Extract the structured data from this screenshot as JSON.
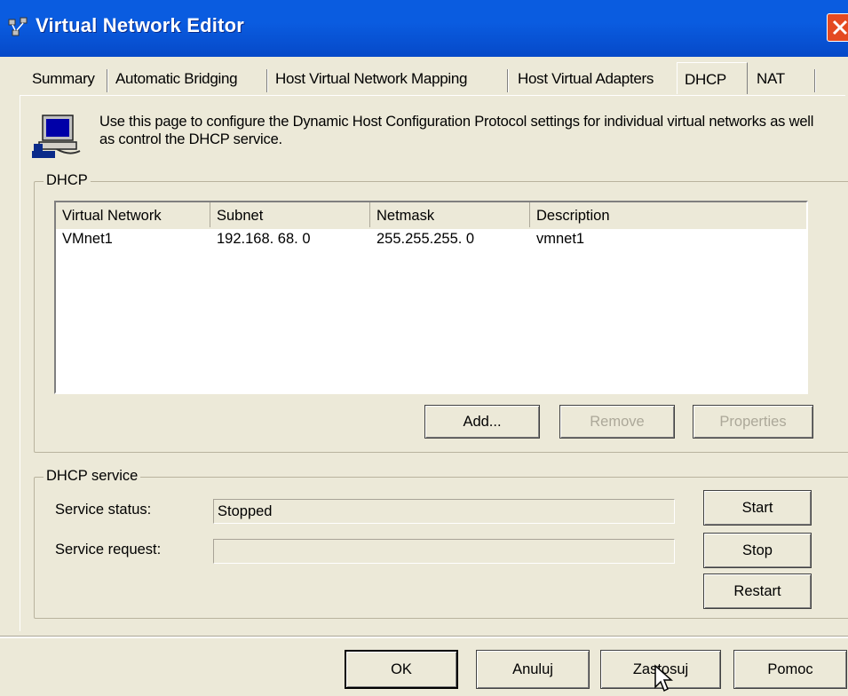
{
  "window": {
    "title": "Virtual Network Editor"
  },
  "tabs": [
    {
      "label": "Summary"
    },
    {
      "label": "Automatic Bridging"
    },
    {
      "label": "Host Virtual Network Mapping"
    },
    {
      "label": "Host Virtual Adapters"
    },
    {
      "label": "DHCP",
      "selected": true
    },
    {
      "label": "NAT"
    }
  ],
  "intro": {
    "text": "Use this page to configure the Dynamic Host Configuration Protocol settings for individual virtual networks as well as control the DHCP service."
  },
  "dhcp": {
    "group_label": "DHCP",
    "columns": [
      "Virtual Network",
      "Subnet",
      "Netmask",
      "Description"
    ],
    "rows": [
      {
        "network": "VMnet1",
        "subnet": "192.168. 68.  0",
        "netmask": "255.255.255.  0",
        "description": "vmnet1"
      }
    ],
    "buttons": {
      "add": "Add...",
      "remove": "Remove",
      "properties": "Properties"
    }
  },
  "service": {
    "group_label": "DHCP service",
    "status_label": "Service status:",
    "status_value": "Stopped",
    "request_label": "Service request:",
    "request_value": "",
    "buttons": {
      "start": "Start",
      "stop": "Stop",
      "restart": "Restart"
    }
  },
  "footer": {
    "ok": "OK",
    "cancel": "Anuluj",
    "apply": "Zastosuj",
    "help": "Pomoc"
  },
  "colors": {
    "titlebar": "#0a5ce0",
    "face": "#ece9d8",
    "disabled_text": "#aca899"
  }
}
